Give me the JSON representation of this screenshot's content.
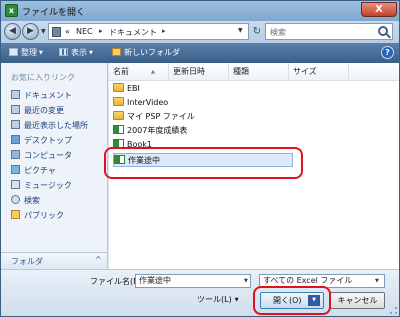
{
  "window": {
    "title": "ファイルを開く",
    "close_label": "X"
  },
  "address": {
    "crumbs": [
      "«",
      "NEC",
      "ドキュメント"
    ],
    "separators": [
      "▸",
      "▸"
    ]
  },
  "search": {
    "placeholder": "検索"
  },
  "toolbar": {
    "organize": "整理",
    "views": "表示",
    "new_folder": "新しいフォルダ",
    "help": "?"
  },
  "nav": {
    "favorites_header": "お気に入りリンク",
    "items": [
      "ドキュメント",
      "最近の変更",
      "最近表示した場所",
      "デスクトップ",
      "コンピュータ",
      "ピクチャ",
      "ミュージック",
      "検索",
      "パブリック"
    ],
    "folders_label": "フォルダ",
    "folders_chevron": "^"
  },
  "columns": [
    "名前",
    "更新日時",
    "種類",
    "サイズ"
  ],
  "files": [
    {
      "name": "EBI",
      "type": "folder"
    },
    {
      "name": "InterVideo",
      "type": "folder"
    },
    {
      "name": "マイ PSP ファイル",
      "type": "folder"
    },
    {
      "name": "2007年度成績表",
      "type": "excel"
    },
    {
      "name": "Book1",
      "type": "excel"
    },
    {
      "name": "作業途中",
      "type": "excel",
      "selected": true
    }
  ],
  "bottom": {
    "filename_label": "ファイル名(N):",
    "filename_value": "作業途中",
    "filetype_value": "すべての Excel ファイル",
    "tools_label": "ツール(L)",
    "open_label": "開く(O)",
    "cancel_label": "キャンセル"
  },
  "colors": {
    "highlight": "#e0121d",
    "toolbar": "#3a5f89",
    "selection": "#dce9f8"
  }
}
